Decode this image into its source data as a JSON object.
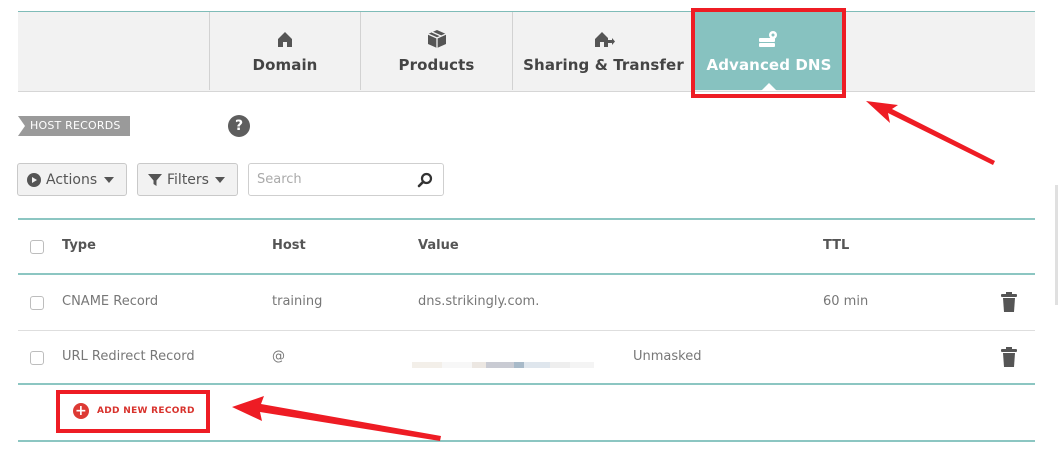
{
  "tabs": [
    {
      "label": "Domain",
      "icon": "home-icon"
    },
    {
      "label": "Products",
      "icon": "box-icon"
    },
    {
      "label": "Sharing & Transfer",
      "icon": "house-transfer-icon"
    },
    {
      "label": "Advanced DNS",
      "icon": "server-settings-icon",
      "active": true
    }
  ],
  "section": {
    "label": "HOST RECORDS",
    "help": "?"
  },
  "toolbar": {
    "actions_label": "Actions",
    "filters_label": "Filters",
    "search_placeholder": "Search"
  },
  "table": {
    "columns": {
      "type": "Type",
      "host": "Host",
      "value": "Value",
      "ttl": "TTL"
    },
    "rows": [
      {
        "type": "CNAME Record",
        "host": "training",
        "value": "dns.strikingly.com.",
        "ttl": "60 min"
      },
      {
        "type": "URL Redirect Record",
        "host": "@",
        "value": "",
        "redirect": "Unmasked"
      }
    ]
  },
  "add_record": {
    "label": "ADD NEW RECORD",
    "plus": "+"
  },
  "colors": {
    "accent": "#87c2c0",
    "highlight": "#ee1c24",
    "add": "#d8322c"
  }
}
